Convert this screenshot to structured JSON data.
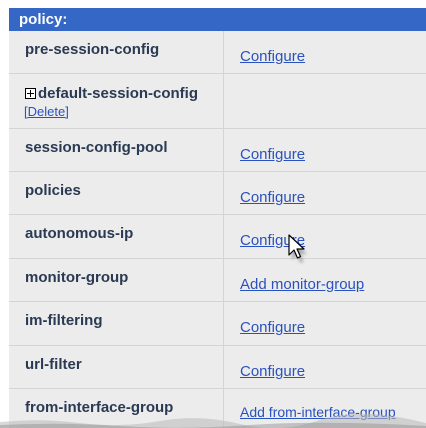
{
  "panel": {
    "title": "policy:"
  },
  "rows": [
    {
      "name": "pre-session-config",
      "action": "Configure"
    },
    {
      "name": "default-session-config",
      "action": "",
      "delete_label": "[Delete]",
      "expandable": true
    },
    {
      "name": "session-config-pool",
      "action": "Configure"
    },
    {
      "name": "policies",
      "action": "Configure"
    },
    {
      "name": "autonomous-ip",
      "action": "Configure"
    },
    {
      "name": "monitor-group",
      "action": "Add monitor-group"
    },
    {
      "name": "im-filtering",
      "action": "Configure"
    },
    {
      "name": "url-filter",
      "action": "Configure"
    },
    {
      "name": "from-interface-group",
      "action": "Add from-interface-group"
    }
  ],
  "colors": {
    "header_bg": "#3567c7",
    "row_bg": "#ececec",
    "link": "#2a52be",
    "name_text": "#2a3a52"
  },
  "icons": {
    "expand": "plus-box-icon",
    "pointer": "mouse-cursor-icon"
  }
}
